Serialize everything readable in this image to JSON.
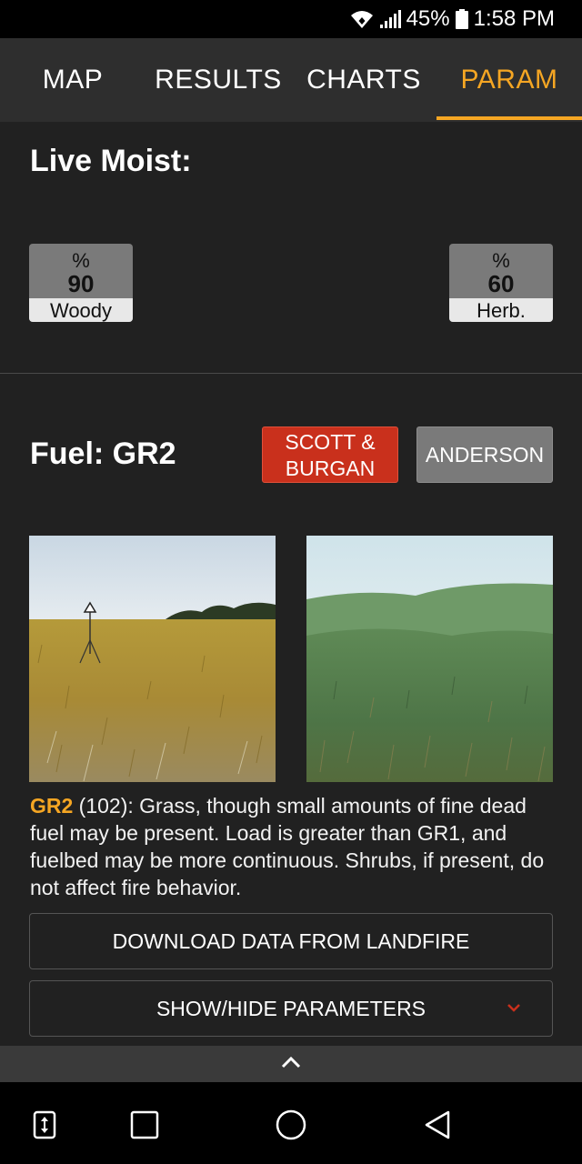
{
  "status_bar": {
    "battery": "45%",
    "time": "1:58 PM"
  },
  "tabs": [
    {
      "label": "MAP"
    },
    {
      "label": "RESULTS"
    },
    {
      "label": "CHARTS"
    },
    {
      "label": "PARAM"
    }
  ],
  "active_tab": "PARAM",
  "accent_color": "#f5a623",
  "live_moist": {
    "heading": "Live Moist:",
    "woody": {
      "unit": "%",
      "value": "90",
      "label": "Woody"
    },
    "herb": {
      "unit": "%",
      "value": "60",
      "label": "Herb."
    }
  },
  "fuel": {
    "heading": "Fuel: GR2",
    "scott_burgan_line1": "SCOTT &",
    "scott_burgan_line2": "BURGAN",
    "anderson_label": "ANDERSON",
    "description_code": "GR2",
    "description_text": " (102): Grass, though small amounts of fine dead fuel may be present. Load is greater than GR1, and fuelbed may be more continuous. Shrubs, if present, do not affect fire behavior."
  },
  "buttons": {
    "download_label": "DOWNLOAD DATA FROM LANDFIRE",
    "show_hide_label": "SHOW/HIDE PARAMETERS"
  },
  "icons": {
    "wifi": "wifi-icon",
    "signal": "signal-icon",
    "battery": "battery-icon",
    "expand_toggle": "chevron-down-icon",
    "collapse_sheet": "chevron-up-icon",
    "nav": [
      "screen-resize-icon",
      "recent-apps-icon",
      "home-icon",
      "back-icon"
    ]
  }
}
